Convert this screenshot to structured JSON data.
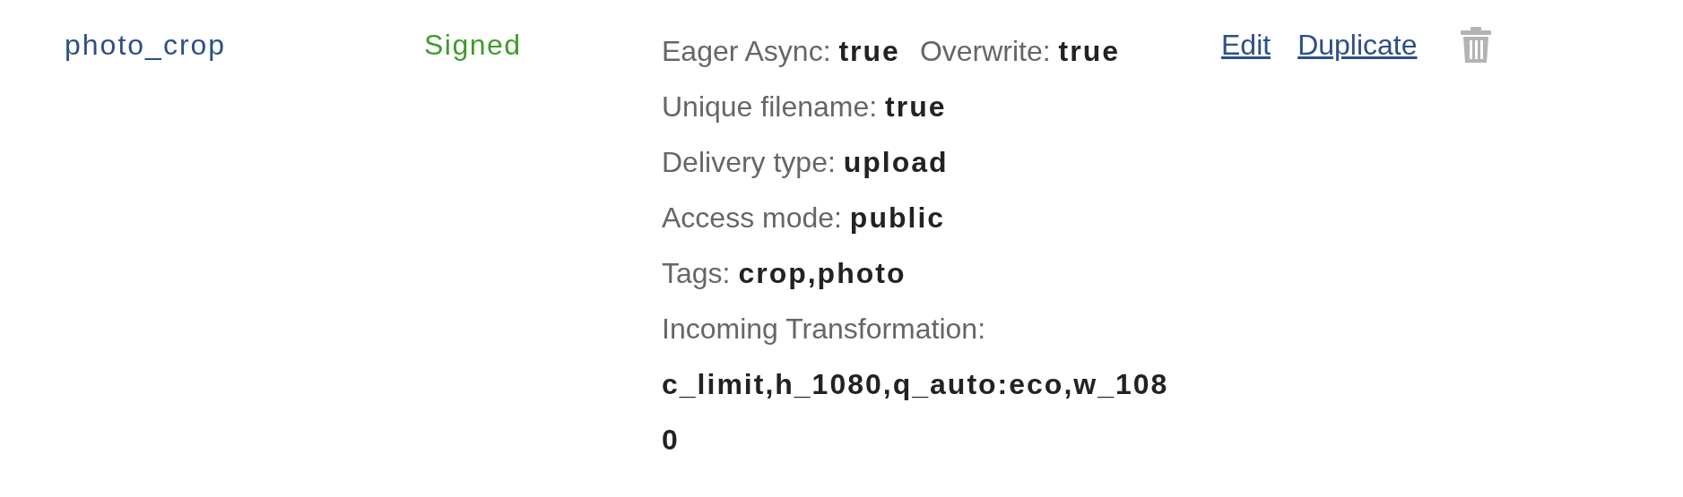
{
  "preset": {
    "name": "photo_crop",
    "status": "Signed",
    "details": [
      [
        {
          "label": "Eager Async:",
          "value": "true"
        },
        {
          "label": "Overwrite:",
          "value": "true"
        }
      ],
      [
        {
          "label": "Unique filename:",
          "value": "true"
        }
      ],
      [
        {
          "label": "Delivery type:",
          "value": "upload"
        }
      ],
      [
        {
          "label": "Access mode:",
          "value": "public"
        }
      ],
      [
        {
          "label": "Tags:",
          "value": "crop,photo"
        }
      ],
      [
        {
          "label": "Incoming Transformation:",
          "value": "c_limit,h_1080,q_auto:eco,w_1080",
          "kind": "block"
        }
      ]
    ],
    "actions": [
      "Edit",
      "Duplicate"
    ]
  }
}
